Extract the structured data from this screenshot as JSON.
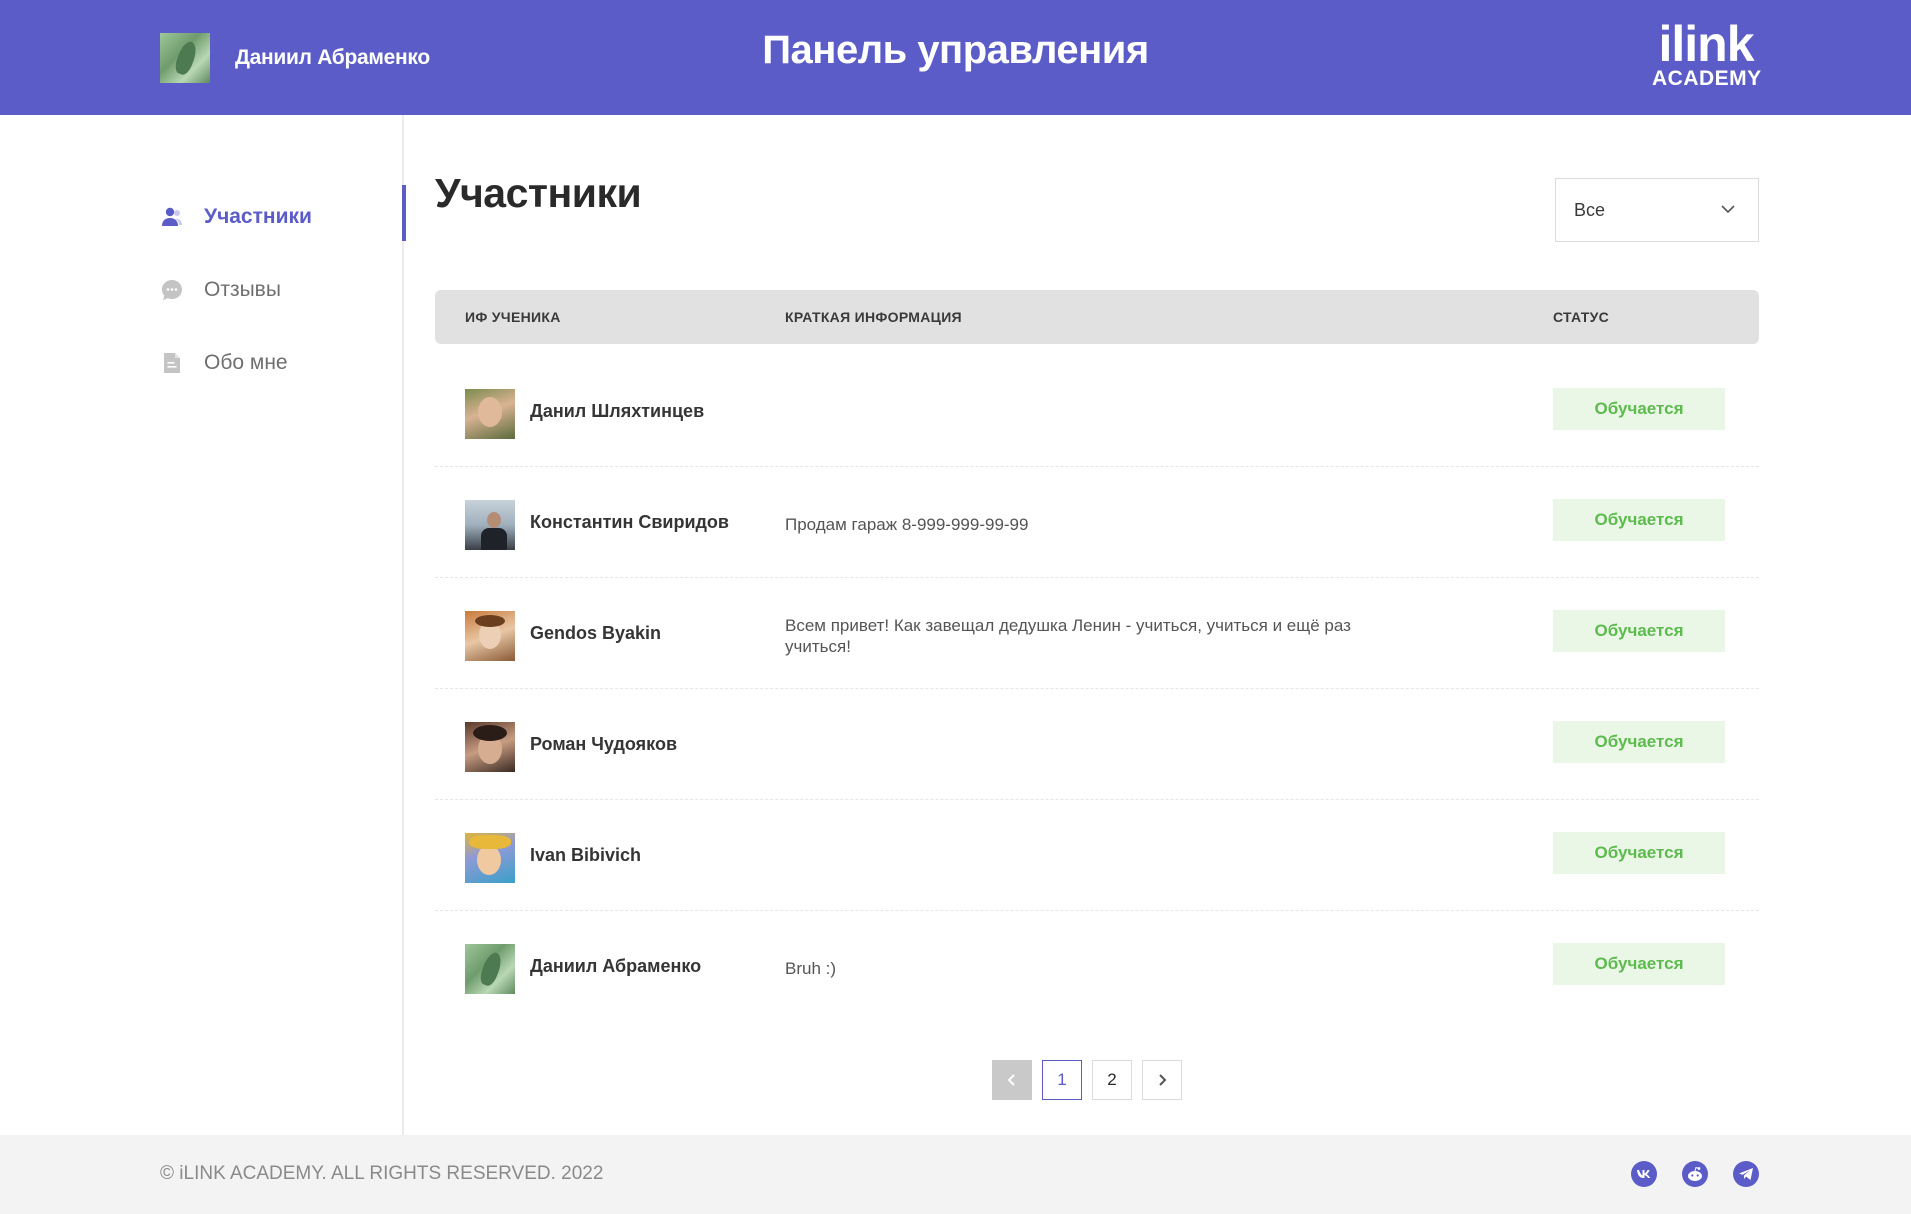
{
  "header": {
    "username": "Даниил Абраменко",
    "title": "Панель управления",
    "logo_main": "ilink",
    "logo_sub": "ACADEMY"
  },
  "sidebar": {
    "items": [
      {
        "label": "Участники",
        "icon": "users-icon",
        "active": true
      },
      {
        "label": "Отзывы",
        "icon": "chat-icon",
        "active": false
      },
      {
        "label": "Обо мне",
        "icon": "document-icon",
        "active": false
      }
    ]
  },
  "main": {
    "title": "Участники",
    "filter": {
      "value": "Все"
    },
    "columns": [
      "ИФ УЧЕНИКА",
      "КРАТКАЯ ИНФОРМАЦИЯ",
      "СТАТУС"
    ],
    "rows": [
      {
        "name": "Данил Шляхтинцев",
        "info": "",
        "status": "Обучается"
      },
      {
        "name": "Константин Свиридов",
        "info": "Продам гараж 8-999-999-99-99",
        "status": "Обучается"
      },
      {
        "name": "Gendos Byakin",
        "info": "Всем привет! Как завещал дедушка Ленин - учиться, учиться и ещё раз учиться!",
        "status": "Обучается"
      },
      {
        "name": "Роман Чудояков",
        "info": "",
        "status": "Обучается"
      },
      {
        "name": "Ivan Bibivich",
        "info": "",
        "status": "Обучается"
      },
      {
        "name": "Даниил Абраменко",
        "info": "Bruh :)",
        "status": "Обучается"
      }
    ]
  },
  "pagination": {
    "pages": [
      "1",
      "2"
    ],
    "current": "1"
  },
  "footer": {
    "copyright": "© iLINK ACADEMY. ALL RIGHTS RESERVED. 2022",
    "social": [
      "vk-icon",
      "reddit-icon",
      "telegram-icon"
    ]
  },
  "colors": {
    "accent": "#5b5cc8",
    "status_bg": "#eaf7e6",
    "status_text": "#5dbb4e"
  }
}
